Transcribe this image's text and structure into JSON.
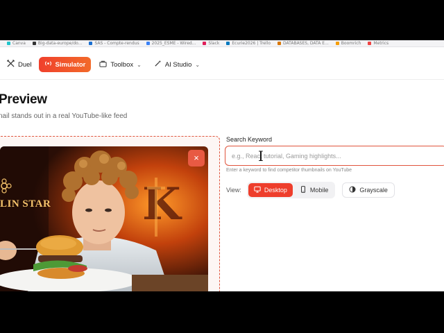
{
  "bookmarks": [
    {
      "label": "Canva",
      "color": "#20c4cb"
    },
    {
      "label": "Big-data-europe/do...",
      "color": "#333333"
    },
    {
      "label": "SAS - Compte-rendus",
      "color": "#1a6fd1"
    },
    {
      "label": "2025_ESME - Wired...",
      "color": "#3b82f6"
    },
    {
      "label": "Slack",
      "color": "#e01e5a"
    },
    {
      "label": "Ecurie2026 | Trello",
      "color": "#0079bf"
    },
    {
      "label": "DATABASES, DATA E...",
      "color": "#d97706"
    },
    {
      "label": "Boomrich",
      "color": "#f59e0b"
    },
    {
      "label": "Metrics",
      "color": "#ef4444"
    }
  ],
  "nav": {
    "duel": "Duel",
    "simulator": "Simulator",
    "toolbox": "Toolbox",
    "ai_studio": "AI Studio"
  },
  "page": {
    "title": "Preview",
    "subtitle": "nail stands out in a real YouTube-like feed"
  },
  "thumbnail": {
    "overlay_text": "LIN STAR",
    "close_label": "×"
  },
  "search": {
    "label": "Search Keyword",
    "placeholder": "e.g., React tutorial, Gaming highlights...",
    "helper": "Enter a keyword to find competitor thumbnails on YouTube"
  },
  "view": {
    "label": "View:",
    "desktop": "Desktop",
    "mobile": "Mobile",
    "grayscale": "Grayscale"
  },
  "colors": {
    "accent": "#ee3e2c",
    "accent_gradient_end": "#f26a2a"
  }
}
